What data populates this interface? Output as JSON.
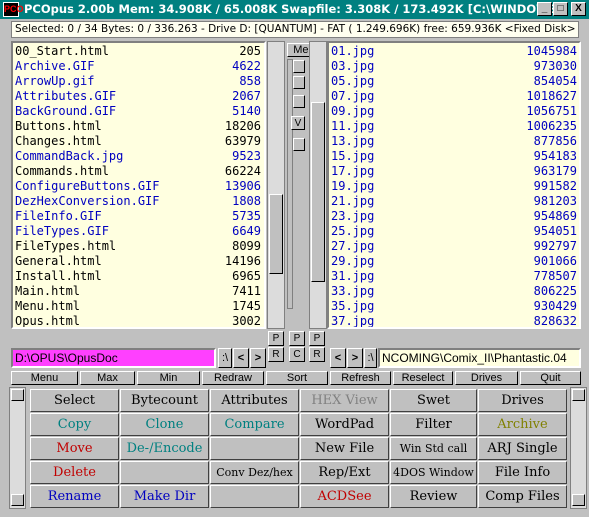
{
  "title": {
    "text": "PCOpus 2.00b  Mem:  34.908K / 65.008K Swapfile:  3.308K / 173.492K [C:\\WINDOWS]",
    "icon_label": "PCO",
    "minimize": "_",
    "maximize": "□",
    "close": "X"
  },
  "status_text": "Selected:  0 / 34 Bytes:  0 / 336.263  - Drive D: [QUANTUM] - FAT ( 1.249.696K) free:  659.936K <Fixed Disk> Buffe",
  "left_files": [
    {
      "name": "00_Start.html",
      "size": "205",
      "color": "blk"
    },
    {
      "name": "Archive.GIF",
      "size": "4622",
      "color": "blu"
    },
    {
      "name": "ArrowUp.gif",
      "size": "858",
      "color": "blu"
    },
    {
      "name": "Attributes.GIF",
      "size": "2067",
      "color": "blu"
    },
    {
      "name": "BackGround.GIF",
      "size": "5140",
      "color": "blu"
    },
    {
      "name": "Buttons.html",
      "size": "18206",
      "color": "blk"
    },
    {
      "name": "Changes.html",
      "size": "63979",
      "color": "blk"
    },
    {
      "name": "CommandBack.jpg",
      "size": "9523",
      "color": "blu"
    },
    {
      "name": "Commands.html",
      "size": "66224",
      "color": "blk"
    },
    {
      "name": "ConfigureButtons.GIF",
      "size": "13906",
      "color": "blu"
    },
    {
      "name": "DezHexConversion.GIF",
      "size": "1808",
      "color": "blu"
    },
    {
      "name": "FileInfo.GIF",
      "size": "5735",
      "color": "blu"
    },
    {
      "name": "FileTypes.GIF",
      "size": "6649",
      "color": "blu"
    },
    {
      "name": "FileTypes.html",
      "size": "8099",
      "color": "blk"
    },
    {
      "name": "General.html",
      "size": "14196",
      "color": "blk"
    },
    {
      "name": "Install.html",
      "size": "6965",
      "color": "blk"
    },
    {
      "name": "Main.html",
      "size": "7411",
      "color": "blk"
    },
    {
      "name": "Menu.html",
      "size": "1745",
      "color": "blk"
    },
    {
      "name": "Opus.html",
      "size": "3002",
      "color": "blk"
    }
  ],
  "right_files": [
    {
      "name": "01.jpg",
      "size": "1045984",
      "color": "blu"
    },
    {
      "name": "03.jpg",
      "size": "973030",
      "color": "blu"
    },
    {
      "name": "05.jpg",
      "size": "854054",
      "color": "blu"
    },
    {
      "name": "07.jpg",
      "size": "1018627",
      "color": "blu"
    },
    {
      "name": "09.jpg",
      "size": "1056751",
      "color": "blu"
    },
    {
      "name": "11.jpg",
      "size": "1006235",
      "color": "blu"
    },
    {
      "name": "13.jpg",
      "size": "877856",
      "color": "blu"
    },
    {
      "name": "15.jpg",
      "size": "954183",
      "color": "blu"
    },
    {
      "name": "17.jpg",
      "size": "963179",
      "color": "blu"
    },
    {
      "name": "19.jpg",
      "size": "991582",
      "color": "blu"
    },
    {
      "name": "21.jpg",
      "size": "981203",
      "color": "blu"
    },
    {
      "name": "23.jpg",
      "size": "954869",
      "color": "blu"
    },
    {
      "name": "25.jpg",
      "size": "954051",
      "color": "blu"
    },
    {
      "name": "27.jpg",
      "size": "992797",
      "color": "blu"
    },
    {
      "name": "29.jpg",
      "size": "901066",
      "color": "blu"
    },
    {
      "name": "31.jpg",
      "size": "778507",
      "color": "blu"
    },
    {
      "name": "33.jpg",
      "size": "806225",
      "color": "blu"
    },
    {
      "name": "35.jpg",
      "size": "930429",
      "color": "blu"
    },
    {
      "name": "37.jpg",
      "size": "828632",
      "color": "blu"
    }
  ],
  "center": {
    "menu_label": "Menu",
    "v_label": "V",
    "p_label": "P",
    "r_label": "R",
    "c_label": "C"
  },
  "left_path": "D:\\OPUS\\OpusDoc",
  "right_path": "NCOMING\\Comix_II\\Phantastic.04",
  "nav": {
    "backslash": ":\\",
    "lt": "<",
    "gt": ">",
    "colon_bs": ":\\"
  },
  "bottom_menu": [
    "Menu",
    "Max",
    "Min",
    "Redraw",
    "Sort",
    "Refresh",
    "Reselect",
    "Drives",
    "Quit"
  ],
  "buttons": [
    [
      {
        "label": "Select",
        "color": "#000"
      },
      {
        "label": "Bytecount",
        "color": "#000"
      },
      {
        "label": "Attributes",
        "color": "#000"
      },
      {
        "label": "HEX View",
        "color": "#808080"
      },
      {
        "label": "Swet",
        "color": "#000"
      },
      {
        "label": "Drives",
        "color": "#000"
      }
    ],
    [
      {
        "label": "Copy",
        "color": "#008080"
      },
      {
        "label": "Clone",
        "color": "#008080"
      },
      {
        "label": "Compare",
        "color": "#008080"
      },
      {
        "label": "WordPad",
        "color": "#000"
      },
      {
        "label": "Filter",
        "color": "#000"
      },
      {
        "label": "Archive",
        "color": "#808000"
      }
    ],
    [
      {
        "label": "Move",
        "color": "#c00000"
      },
      {
        "label": "De-/Encode",
        "color": "#008080"
      },
      {
        "label": "",
        "color": "#000"
      },
      {
        "label": "New File",
        "color": "#000"
      },
      {
        "label": "Win Std call",
        "color": "#000"
      },
      {
        "label": "ARJ Single",
        "color": "#000"
      }
    ],
    [
      {
        "label": "Delete",
        "color": "#c00000"
      },
      {
        "label": "",
        "color": "#000"
      },
      {
        "label": "Conv Dez/hex",
        "color": "#000"
      },
      {
        "label": "Rep/Ext",
        "color": "#000"
      },
      {
        "label": "4DOS Window",
        "color": "#000"
      },
      {
        "label": "File Info",
        "color": "#000"
      }
    ],
    [
      {
        "label": "Rename",
        "color": "#0000c0"
      },
      {
        "label": "Make Dir",
        "color": "#0000c0"
      },
      {
        "label": "",
        "color": "#000"
      },
      {
        "label": "ACDSee",
        "color": "#c00000"
      },
      {
        "label": "Review",
        "color": "#000"
      },
      {
        "label": "Comp Files",
        "color": "#000"
      }
    ]
  ]
}
